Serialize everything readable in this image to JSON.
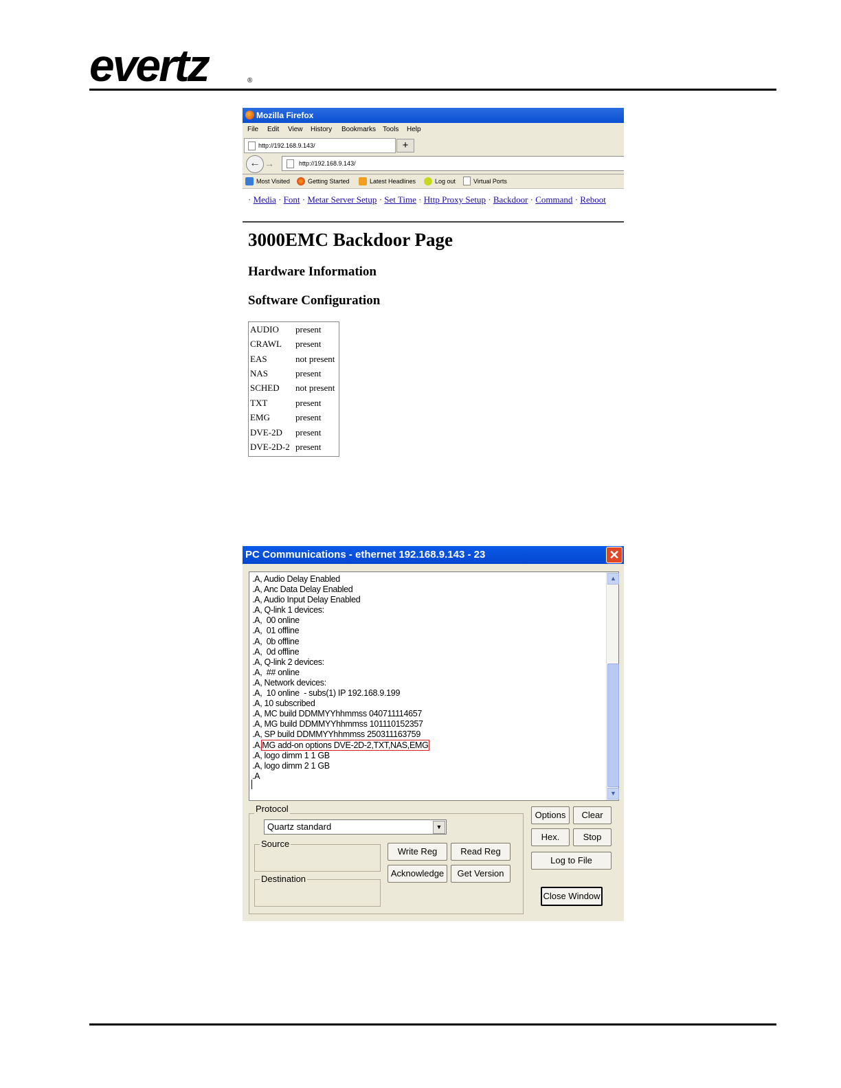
{
  "logo": {
    "text": "evertz",
    "registered": "®"
  },
  "firefox": {
    "window_title": "Mozilla Firefox",
    "menu": [
      "File",
      "Edit",
      "View",
      "History",
      "Bookmarks",
      "Tools",
      "Help"
    ],
    "tab_label": "http://192.168.9.143/",
    "new_tab": "+",
    "url": "http://192.168.9.143/",
    "bookmarks": [
      "Most Visited",
      "Getting Started",
      "Latest Headlines",
      "Log out",
      "Virtual Ports"
    ],
    "nav_links": [
      "Media",
      "Font",
      "Metar Server Setup",
      "Set Time",
      "Http Proxy Setup",
      "Backdoor",
      "Command",
      "Reboot"
    ],
    "page_title": "3000EMC Backdoor Page",
    "section_hardware": "Hardware Information",
    "section_software": "Software Configuration",
    "modules": [
      {
        "name": "AUDIO",
        "status": "present"
      },
      {
        "name": "CRAWL",
        "status": "present"
      },
      {
        "name": "EAS",
        "status": "not present"
      },
      {
        "name": "NAS",
        "status": "present"
      },
      {
        "name": "SCHED",
        "status": "not present"
      },
      {
        "name": "TXT",
        "status": "present"
      },
      {
        "name": "EMG",
        "status": "present"
      },
      {
        "name": "DVE-2D",
        "status": "present"
      },
      {
        "name": "DVE-2D-2",
        "status": "present"
      }
    ]
  },
  "pc_comm": {
    "window_title": "PC Communications - ethernet 192.168.9.143 - 23",
    "close": "✕",
    "console_lines": [
      ".A, Audio Delay Enabled",
      ".A, Anc Data Delay Enabled",
      ".A, Audio Input Delay Enabled",
      ".A, Q-link 1 devices:",
      ".A,  00 online",
      ".A,  01 offline",
      ".A,  0b offline",
      ".A,  0d offline",
      ".A, Q-link 2 devices:",
      ".A,  ## online",
      ".A, Network devices:",
      ".A,  10 online  - subs(1) IP 192.168.9.199",
      ".A, 10 subscribed",
      ".A, MC build DDMMYYhhmmss 040711114657",
      ".A, MG build DDMMYYhhmmss 101110152357",
      ".A, SP build DDMMYYhhmmss 250311163759"
    ],
    "highlight_prefix": ".A,",
    "highlight_text": "MG add-on options DVE-2D-2,TXT,NAS,EMG",
    "console_lines_after": [
      ".A, logo dimm 1 1 GB",
      ".A, logo dimm 2 1 GB",
      ".A"
    ],
    "protocol_label": "Protocol",
    "protocol_value": "Quartz standard",
    "source_label": "Source",
    "destination_label": "Destination",
    "buttons": {
      "write_reg": "Write Reg",
      "read_reg": "Read Reg",
      "acknowledge": "Acknowledge",
      "get_version": "Get Version",
      "options": "Options",
      "clear": "Clear",
      "hex": "Hex.",
      "stop": "Stop",
      "log_to_file": "Log to File",
      "close_window": "Close Window"
    }
  }
}
